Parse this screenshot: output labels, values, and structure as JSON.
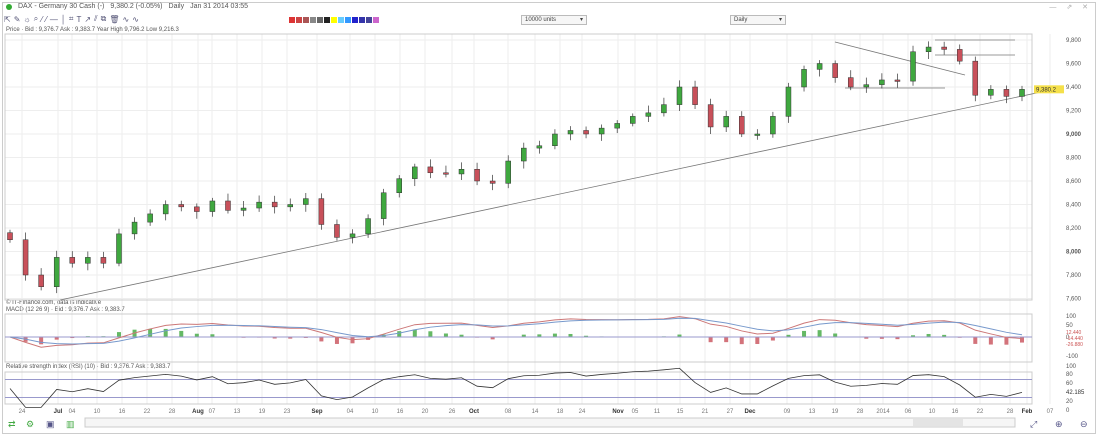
{
  "window": {
    "title": "DAX - Germany 30 Cash (-)",
    "price": "9,380.2 (-0.05%)",
    "period": "Daily",
    "datetime": "Jan 31 2014 03:55",
    "controls": "— ⇗ ✕"
  },
  "toolbar": {
    "icons": [
      "pointer-icon",
      "pencil-icon",
      "bulb-icon",
      "magnifier-icon",
      "line-icon",
      "ray-icon",
      "horizontal-line-icon",
      "vertical-line-icon",
      "fib-icon",
      "text-icon",
      "arrow-icon",
      "channel-icon",
      "layers-icon",
      "trash-icon",
      "indicator-icon",
      "study-icon"
    ],
    "units": "10000 units",
    "interval": "Daily"
  },
  "price_header": "Price  ·  Bid : 9,376.7  Ask : 9,383.7  Year High 9,796.2  Low 9,216.3",
  "attribution": "© IT-Finance.com, data is indicative",
  "macd_header": "MACD (12 26 9)  ·  Bid : 9,376.7  Ask : 9,383.7",
  "rsi_header": "Relative strength index (RSI) (10)  ·  Bid : 9,376.7  Ask : 9,383.7",
  "colors": {
    "up": "#3fa83f",
    "down": "#c8505a",
    "macd_pos": "#9be39b",
    "macd_neg": "#f2a9b0",
    "price_tag": "#f5e04a"
  },
  "chart_data": {
    "type": "candlestick",
    "title": "DAX - Germany 30 Cash (-) Daily",
    "ylim": [
      7600,
      9900
    ],
    "y_ticks": [
      "9,800",
      "9,600",
      "9,400",
      "9,200",
      "9,000",
      "8,800",
      "8,600",
      "8,400",
      "8,200",
      "8,000",
      "7,800",
      "7,600"
    ],
    "last_price": "9,380.2",
    "closes": [
      8100,
      7800,
      7700,
      7950,
      7900,
      7950,
      7900,
      8150,
      8250,
      8320,
      8400,
      8380,
      8340,
      8430,
      8350,
      8370,
      8420,
      8380,
      8400,
      8450,
      8230,
      8120,
      8150,
      8280,
      8500,
      8620,
      8720,
      8670,
      8660,
      8700,
      8600,
      8580,
      8770,
      8880,
      8900,
      9000,
      9030,
      9000,
      9050,
      9090,
      9150,
      9180,
      9250,
      9400,
      9250,
      9060,
      9150,
      9000,
      9000,
      9150,
      9400,
      9550,
      9600,
      9480,
      9400,
      9420,
      9460,
      9450,
      9700,
      9740,
      9720,
      9620,
      9330,
      9380,
      9320,
      9380
    ],
    "x_ticks": [
      "24",
      "Jul",
      "04",
      "10",
      "16",
      "22",
      "28",
      "Aug",
      "07",
      "13",
      "19",
      "23",
      "Sep",
      "04",
      "10",
      "16",
      "20",
      "26",
      "Oct",
      "08",
      "14",
      "18",
      "24",
      "Nov",
      "05",
      "11",
      "15",
      "21",
      "27",
      "Dec",
      "09",
      "13",
      "19",
      "28",
      "2014",
      "06",
      "10",
      "16",
      "22",
      "28",
      "Feb",
      "07"
    ],
    "macd": {
      "ylim": [
        -100,
        100
      ],
      "y_ticks": [
        "100",
        "50",
        "0",
        "-100"
      ],
      "readouts": [
        "12.440",
        "-14.440",
        "-26.880"
      ]
    },
    "rsi": {
      "ylim": [
        0,
        100
      ],
      "y_ticks": [
        "100",
        "80",
        "60",
        "20",
        "0"
      ],
      "value": "42.185",
      "bands": [
        70,
        30
      ]
    }
  },
  "footer": {
    "icons": [
      "compare-icon",
      "indicator-add-icon",
      "save-icon",
      "layout-icon",
      "zoom-fit-icon",
      "zoom-in-icon",
      "zoom-out-icon"
    ]
  }
}
